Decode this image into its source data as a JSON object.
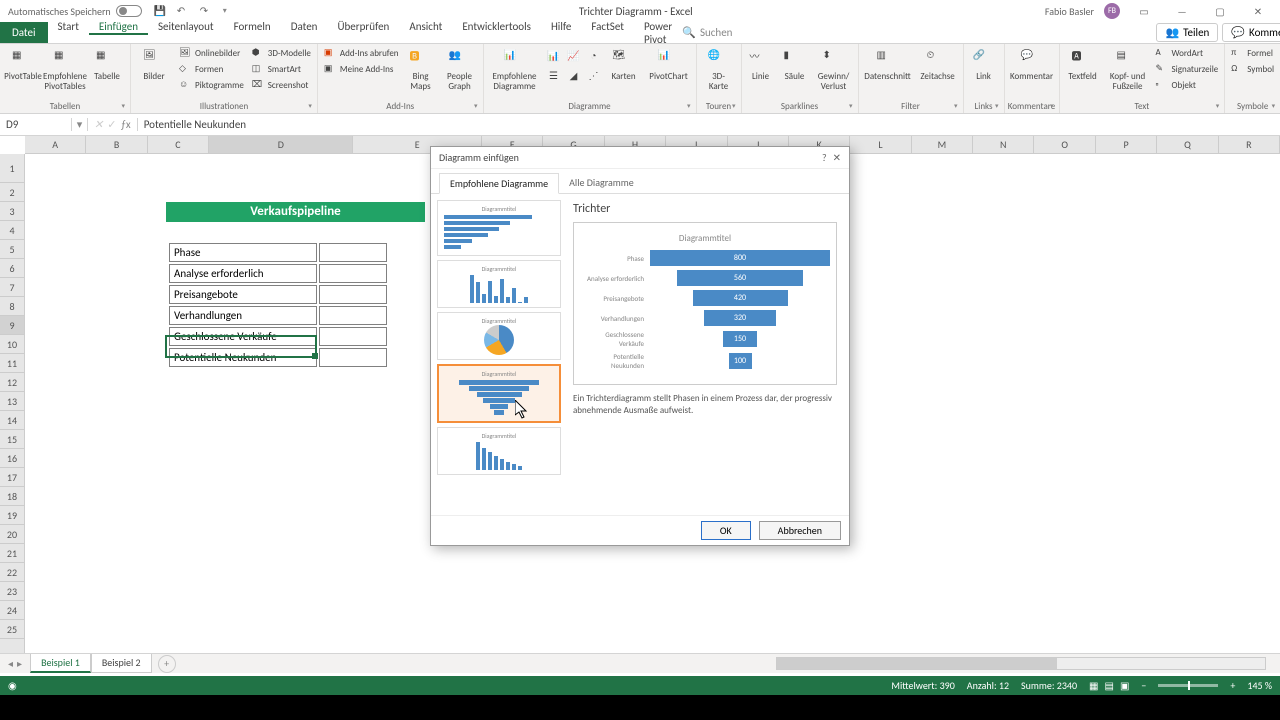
{
  "titlebar": {
    "autosave": "Automatisches Speichern",
    "doc_title": "Trichter Diagramm - Excel",
    "user": "Fabio Basler",
    "user_initials": "FB"
  },
  "tabs": {
    "file": "Datei",
    "list": [
      "Start",
      "Einfügen",
      "Seitenlayout",
      "Formeln",
      "Daten",
      "Überprüfen",
      "Ansicht",
      "Entwicklertools",
      "Hilfe",
      "FactSet",
      "Power Pivot"
    ],
    "active": "Einfügen",
    "search": "Suchen",
    "share": "Teilen",
    "comments": "Kommentare"
  },
  "ribbon": {
    "tables": {
      "pivot": "PivotTable",
      "recommended": "Empfohlene\nPivotTables",
      "table": "Tabelle",
      "label": "Tabellen"
    },
    "illustrations": {
      "images": "Bilder",
      "models": "3D-Modelle",
      "shapes": "Formen",
      "smartart": "SmartArt",
      "icons": "Piktogramme",
      "screenshot": "Screenshot",
      "onlineimg": "Onlinebilder",
      "label": "Illustrationen"
    },
    "addins": {
      "get": "Add-Ins abrufen",
      "my": "Meine Add-Ins",
      "bing": "Bing\nMaps",
      "people": "People\nGraph",
      "label": "Add-Ins"
    },
    "charts": {
      "recommended": "Empfohlene\nDiagramme",
      "maps": "Karten",
      "pivotchart": "PivotChart",
      "label": "Diagramme"
    },
    "tours": {
      "globe": "3D-\nKarte",
      "label": "Touren"
    },
    "sparklines": {
      "line": "Linie",
      "col": "Säule",
      "winloss": "Gewinn/\nVerlust",
      "label": "Sparklines"
    },
    "filter": {
      "slicer": "Datenschnitt",
      "timeline": "Zeitachse",
      "label": "Filter"
    },
    "links": {
      "link": "Link",
      "label": "Links"
    },
    "comments": {
      "comment": "Kommentar",
      "label": "Kommentare"
    },
    "text": {
      "textbox": "Textfeld",
      "headerfooter": "Kopf- und\nFußzeile",
      "wordart": "WordArt",
      "sig": "Signaturzeile",
      "obj": "Objekt",
      "label": "Text"
    },
    "symbols": {
      "formula": "Formel",
      "symbol": "Symbol",
      "label": "Symbole"
    }
  },
  "formula_bar": {
    "cell": "D9",
    "value": "Potentielle Neukunden"
  },
  "sheet": {
    "cols": [
      "A",
      "B",
      "C",
      "D",
      "E",
      "F",
      "G",
      "H",
      "I",
      "J",
      "K",
      "L",
      "M",
      "N",
      "O",
      "P",
      "Q",
      "R"
    ],
    "rows": 25,
    "pipeline_title": "Verkaufspipeline",
    "phases": [
      "Phase",
      "Analyse erforderlich",
      "Preisangebote",
      "Verhandlungen",
      "Geschlossene Verkäufe",
      "Potentielle Neukunden"
    ]
  },
  "dialog": {
    "title": "Diagramm einfügen",
    "tab1": "Empfohlene Diagramme",
    "tab2": "Alle Diagramme",
    "chart_type": "Trichter",
    "chart_title": "Diagrammtitel",
    "description": "Ein Trichterdiagramm stellt Phasen in einem Prozess dar, der progressiv abnehmende Ausmaße aufweist.",
    "ok": "OK",
    "cancel": "Abbrechen"
  },
  "chart_data": {
    "type": "funnel",
    "title": "Diagrammtitel",
    "categories": [
      "Phase",
      "Analyse erforderlich",
      "Preisangebote",
      "Verhandlungen",
      "Geschlossene Verkäufe",
      "Potentielle Neukunden"
    ],
    "values": [
      800,
      560,
      420,
      320,
      150,
      100
    ]
  },
  "sheets": {
    "list": [
      "Beispiel 1",
      "Beispiel 2"
    ],
    "active": "Beispiel 1"
  },
  "status": {
    "mean": "Mittelwert: 390",
    "count": "Anzahl: 12",
    "sum": "Summe: 2340",
    "zoom": "145 %"
  }
}
